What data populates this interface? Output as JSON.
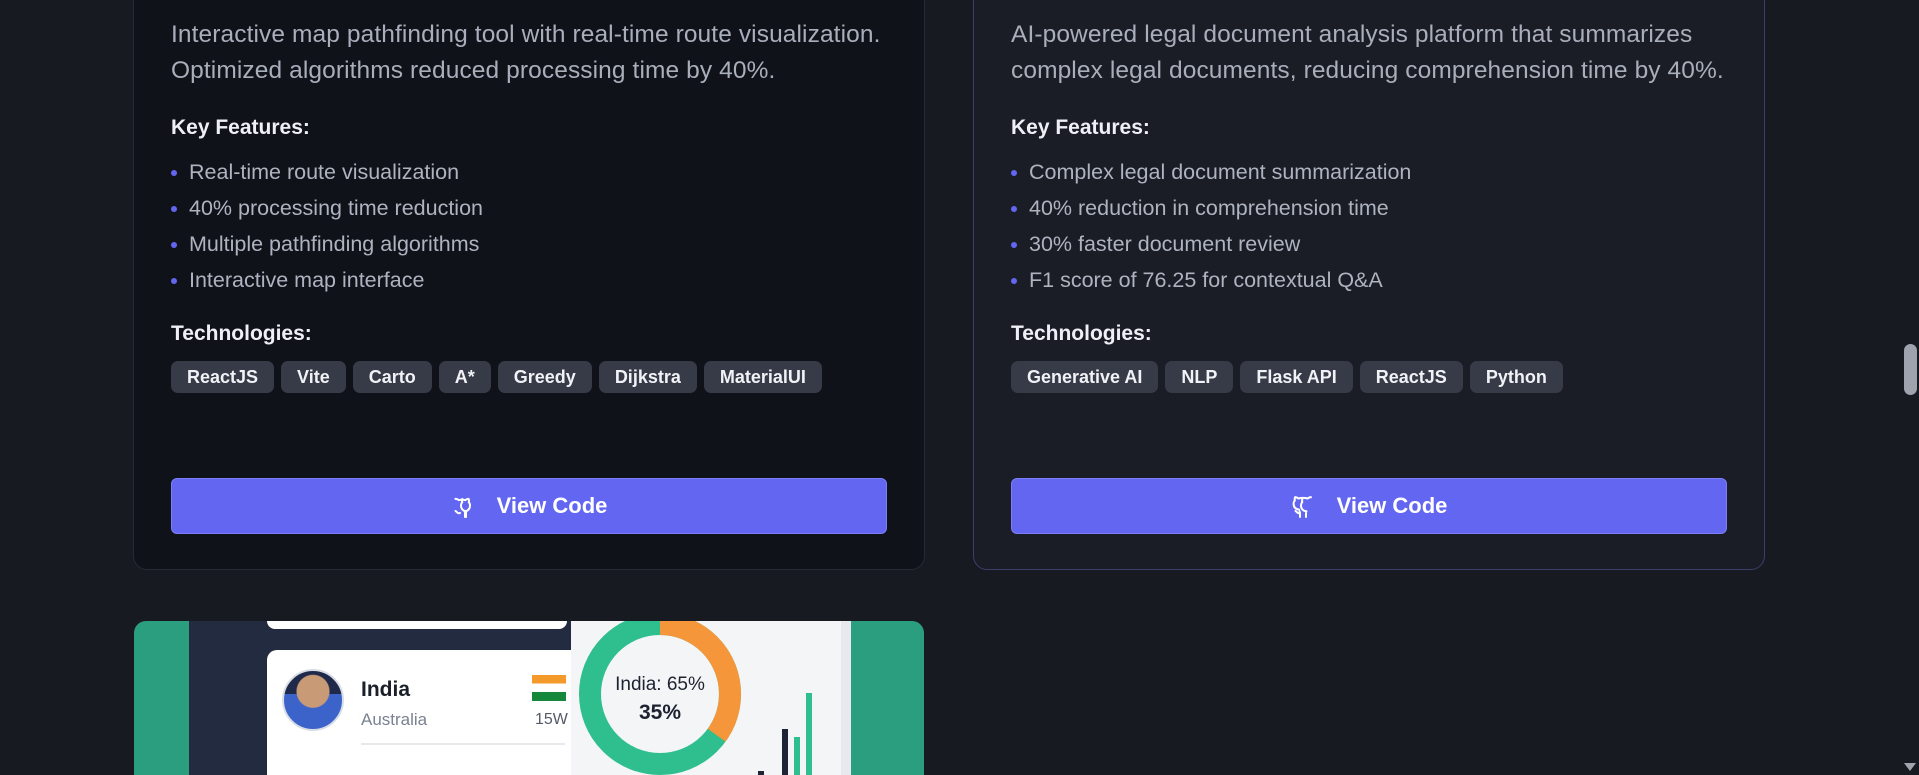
{
  "projects": [
    {
      "description": "Interactive map pathfinding tool with real-time route visualization. Optimized algorithms reduced processing time by 40%.",
      "features_title": "Key Features:",
      "features": [
        "Real-time route visualization",
        "40% processing time reduction",
        "Multiple pathfinding algorithms",
        "Interactive map interface"
      ],
      "tech_title": "Technologies:",
      "tags": [
        "ReactJS",
        "Vite",
        "Carto",
        "A*",
        "Greedy",
        "Dijkstra",
        "MaterialUI"
      ],
      "button_label": "View Code",
      "button_icon": "github-icon"
    },
    {
      "description": "AI-powered legal document analysis platform that summarizes complex legal documents, reducing comprehension time by 40%.",
      "features_title": "Key Features:",
      "features": [
        "Complex legal document summarization",
        "40% reduction in comprehension time",
        "30% faster document review",
        "F1 score of 76.25 for contextual Q&A"
      ],
      "tech_title": "Technologies:",
      "tags": [
        "Generative AI",
        "NLP",
        "Flask API",
        "ReactJS",
        "Python"
      ],
      "button_label": "View Code",
      "button_icon": "github-icon"
    }
  ],
  "preview": {
    "player_name": "India",
    "player_sub": "Australia",
    "score": "15W",
    "donut_label": "India: 65%",
    "donut_value": "35%",
    "donut_share": 0.65
  },
  "colors": {
    "accent": "#6366f1",
    "background": "#181a21",
    "tag_bg": "#373b47",
    "preview_green": "#2b9e7f",
    "donut_green": "#2fbf8e",
    "donut_orange": "#f5963a"
  }
}
